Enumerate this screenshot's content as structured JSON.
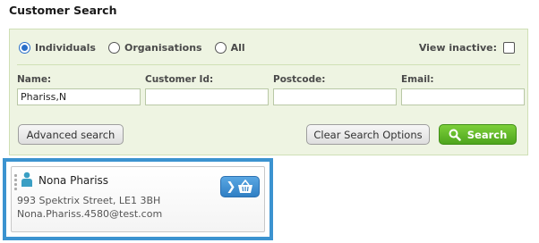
{
  "page": {
    "title": "Customer Search"
  },
  "filters": {
    "radio_options": [
      {
        "label": "Individuals",
        "checked": true
      },
      {
        "label": "Organisations",
        "checked": false
      },
      {
        "label": "All",
        "checked": false
      }
    ],
    "view_inactive_label": "View inactive:",
    "view_inactive_checked": false
  },
  "fields": {
    "name": {
      "label": "Name:",
      "value": "Phariss,N"
    },
    "customer_id": {
      "label": "Customer Id:",
      "value": ""
    },
    "postcode": {
      "label": "Postcode:",
      "value": ""
    },
    "email": {
      "label": "Email:",
      "value": ""
    }
  },
  "buttons": {
    "advanced": "Advanced search",
    "clear": "Clear Search Options",
    "search": "Search"
  },
  "result": {
    "name": "Nona Phariss",
    "address": "993 Spektrix Street, LE1 3BH",
    "email": "Nona.Phariss.4580@test.com"
  },
  "colors": {
    "accent_blue": "#3b93d0",
    "search_green": "#5cb82a",
    "panel_bg": "#eef4e2"
  }
}
